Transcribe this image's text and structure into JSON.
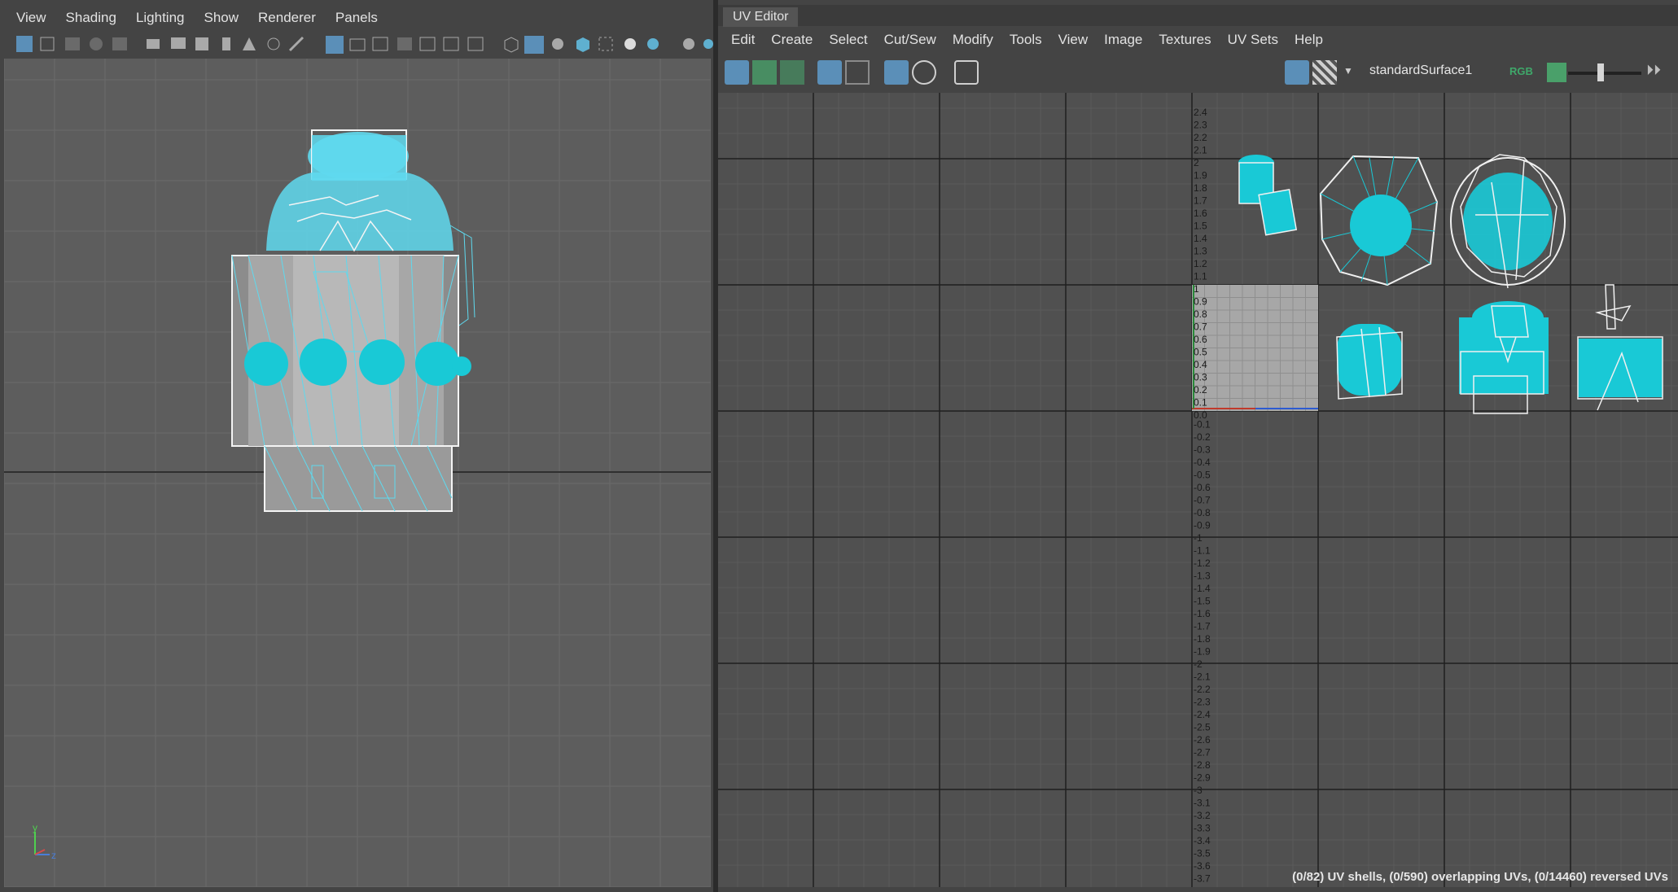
{
  "viewport_panel": {
    "menu": [
      "View",
      "Shading",
      "Lighting",
      "Show",
      "Renderer",
      "Panels"
    ],
    "axis": {
      "y": "y",
      "z": "z"
    }
  },
  "uv_editor": {
    "tab_title": "UV Editor",
    "menu": [
      "Edit",
      "Create",
      "Select",
      "Cut/Sew",
      "Modify",
      "Tools",
      "View",
      "Image",
      "Textures",
      "UV Sets",
      "Help"
    ],
    "material_name": "standardSurface1",
    "rgb_label": "RGB",
    "status": "(0/82) UV shells, (0/590) overlapping UVs, (0/14460) reversed UVs",
    "v_ticks_top": [
      "2.4",
      "2.3",
      "2.2",
      "2.1",
      "2",
      "1.9",
      "1.8",
      "1.7",
      "1.6",
      "1.5",
      "1.4",
      "1.3",
      "1.2",
      "1.1",
      "1",
      "0.9",
      "0.8",
      "0.7",
      "0.6",
      "0.5",
      "0.4",
      "0.3",
      "0.2",
      "0.1",
      "0.0"
    ],
    "v_ticks_bottom": [
      "-0.1",
      "-0.2",
      "-0.3",
      "-0.4",
      "-0.5",
      "-0.6",
      "-0.7",
      "-0.8",
      "-0.9",
      "-1",
      "-1.1",
      "-1.2",
      "-1.3",
      "-1.4",
      "-1.5",
      "-1.6",
      "-1.7",
      "-1.8",
      "-1.9",
      "-2",
      "-2.1",
      "-2.2",
      "-2.3",
      "-2.4",
      "-2.5",
      "-2.6",
      "-2.7",
      "-2.8",
      "-2.9",
      "-3",
      "-3.1",
      "-3.2",
      "-3.3",
      "-3.4",
      "-3.5",
      "-3.6",
      "-3.7"
    ]
  },
  "colors": {
    "wire": "#5fd9ee",
    "uv_fill": "#19c9d6",
    "accent_blue": "#5b8fb8"
  }
}
